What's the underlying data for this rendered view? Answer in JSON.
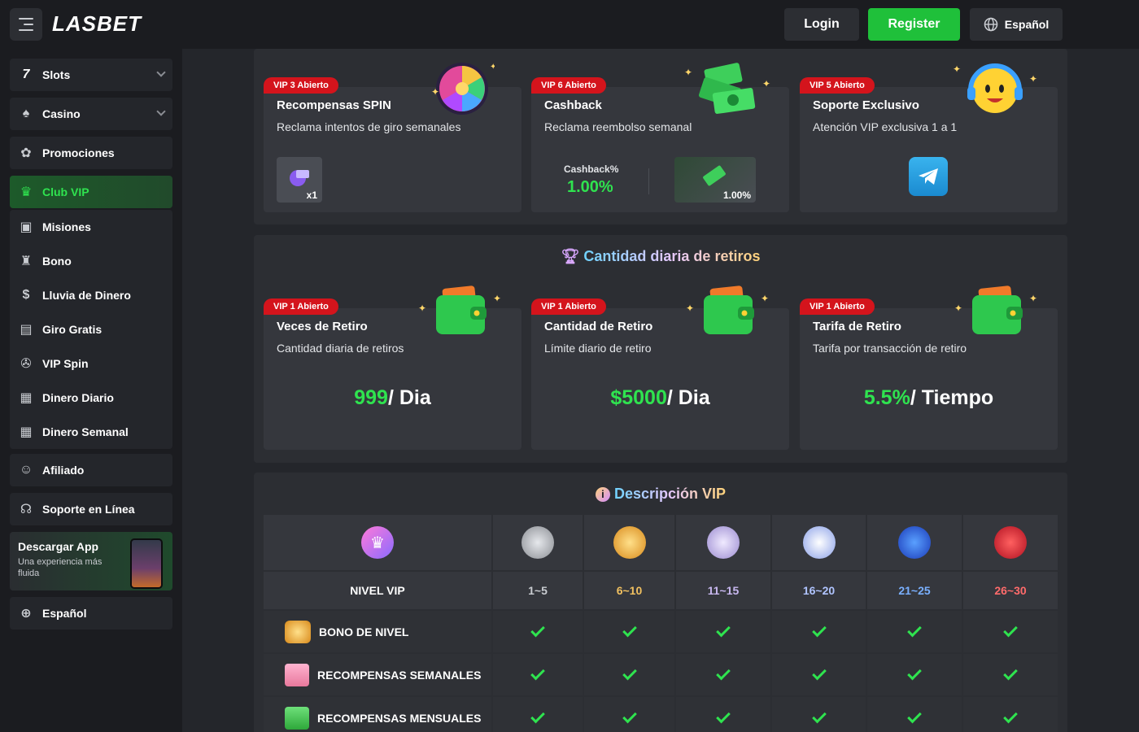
{
  "header": {
    "logo": "LASBET",
    "login": "Login",
    "register": "Register",
    "language": "Español"
  },
  "sidebar": {
    "items": [
      {
        "label": "Slots",
        "icon": "slots-7-icon"
      },
      {
        "label": "Casino",
        "icon": "spade-icon"
      },
      {
        "label": "Promociones",
        "icon": "promo-icon"
      },
      {
        "label": "Club VIP",
        "icon": "crown-icon"
      },
      {
        "label": "Misiones",
        "icon": "clipboard-icon"
      },
      {
        "label": "Bono",
        "icon": "bonus-icon"
      },
      {
        "label": "Lluvia de Dinero",
        "icon": "money-bag-icon"
      },
      {
        "label": "Giro Gratis",
        "icon": "free-spin-icon"
      },
      {
        "label": "VIP Spin",
        "icon": "wheel-icon"
      },
      {
        "label": "Dinero Diario",
        "icon": "calendar-icon"
      },
      {
        "label": "Dinero Semanal",
        "icon": "calendar-7-icon"
      },
      {
        "label": "Afiliado",
        "icon": "affiliate-icon"
      },
      {
        "label": "Soporte en Línea",
        "icon": "headset-icon"
      }
    ],
    "download": {
      "title": "Descargar App",
      "subtitle": "Una experiencia más fluida"
    },
    "language": "Español"
  },
  "rewards": [
    {
      "badge": "VIP 3 Abierto",
      "title": "Recompensas SPIN",
      "subtitle": "Reclama intentos de giro semanales",
      "spin_count": "x1"
    },
    {
      "badge": "VIP 6 Abierto",
      "title": "Cashback",
      "subtitle": "Reclama reembolso semanal",
      "cashback_label": "Cashback%",
      "cashback_value": "1.00%",
      "cashback_box": "1.00%"
    },
    {
      "badge": "VIP 5 Abierto",
      "title": "Soporte Exclusivo",
      "subtitle": "Atención VIP exclusiva 1 a 1"
    }
  ],
  "withdrawals": {
    "title": "Cantidad diaria de retiros",
    "cards": [
      {
        "badge": "VIP 1 Abierto",
        "title": "Veces de Retiro",
        "subtitle": "Cantidad diaria de retiros",
        "value": "999",
        "unit": "/ Dia"
      },
      {
        "badge": "VIP 1 Abierto",
        "title": "Cantidad de Retiro",
        "subtitle": "Límite diario de retiro",
        "value": "$5000",
        "unit": "/ Dia"
      },
      {
        "badge": "VIP 1 Abierto",
        "title": "Tarifa de Retiro",
        "subtitle": "Tarifa por transacción de retiro",
        "value": "5.5%",
        "unit": "/ Tiempo"
      }
    ]
  },
  "vip": {
    "title": "Descripción VIP",
    "level_label": "NIVEL VIP",
    "levels": [
      {
        "range": "1~5",
        "color": "#c9ccd1"
      },
      {
        "range": "6~10",
        "color": "#f0c060"
      },
      {
        "range": "11~15",
        "color": "#c8b8f0"
      },
      {
        "range": "16~20",
        "color": "#b0c4ff"
      },
      {
        "range": "21~25",
        "color": "#7ab0ff"
      },
      {
        "range": "26~30",
        "color": "#ff6b6b"
      }
    ],
    "features": [
      "BONO DE NIVEL",
      "RECOMPENSAS SEMANALES",
      "RECOMPENSAS MENSUALES"
    ]
  }
}
